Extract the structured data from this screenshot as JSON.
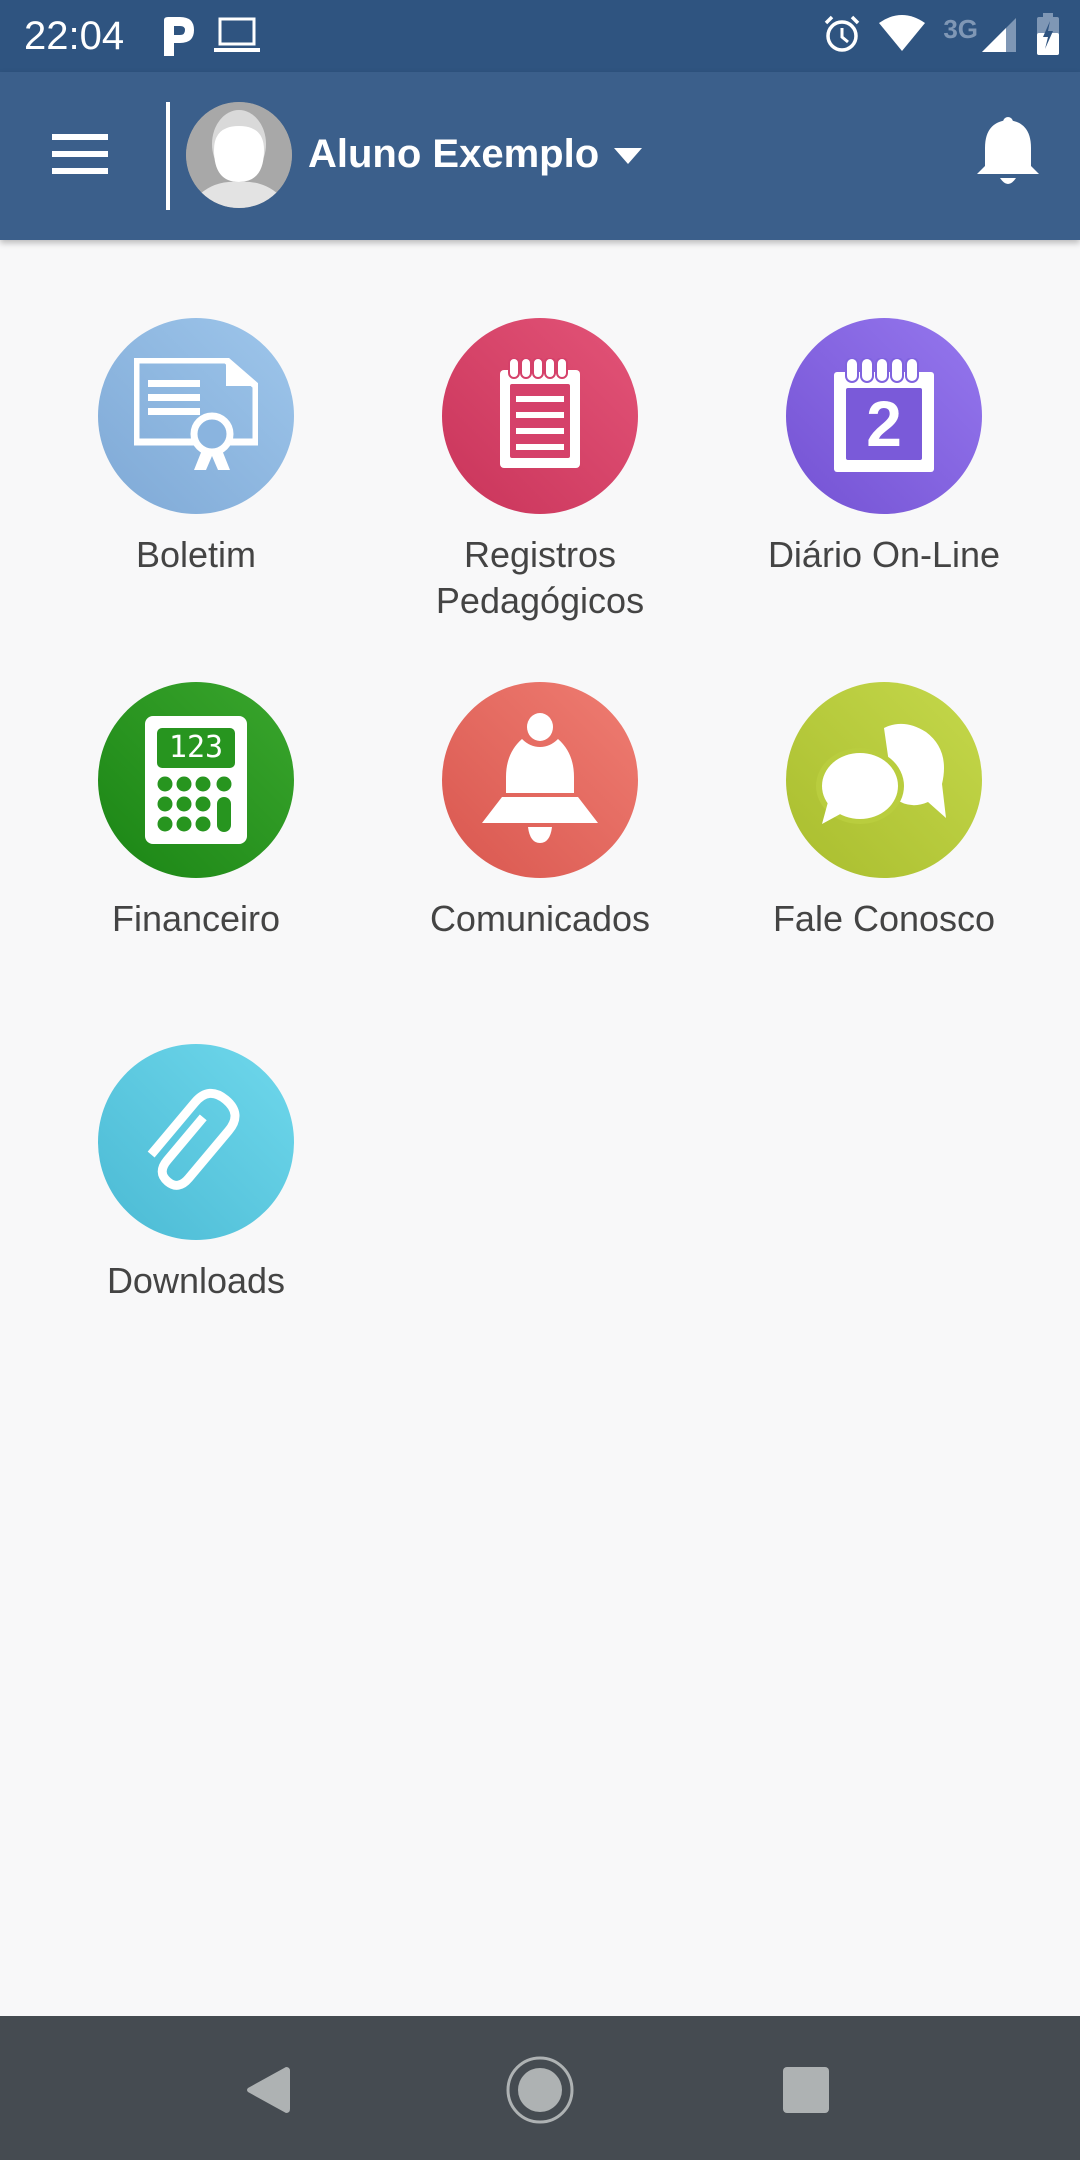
{
  "status_bar": {
    "time": "22:04",
    "left_icons": [
      "parking-p-icon",
      "laptop-icon"
    ],
    "right_icons": [
      "alarm-icon",
      "wifi-icon",
      "signal-icon",
      "battery-charging-icon"
    ],
    "network_label": "3G"
  },
  "app_bar": {
    "menu_icon": "hamburger-menu-icon",
    "profile_name": "Aluno Exemplo",
    "notifications_icon": "bell-icon",
    "color": "#3b5f8b"
  },
  "grid": {
    "items": [
      {
        "label": "Boletim",
        "icon": "certificate-icon",
        "color_start": "#7fa9d6",
        "color_end": "#9ec6eb"
      },
      {
        "label": "Registros Pedagógicos",
        "icon": "notepad-icon",
        "color_start": "#c9345a",
        "color_end": "#e35478"
      },
      {
        "label": "Diário On-Line",
        "icon": "calendar-icon",
        "color_start": "#7452d3",
        "color_end": "#9577ee",
        "calendar_number": "2"
      },
      {
        "label": "Financeiro",
        "icon": "calculator-icon",
        "color_start": "#1b8515",
        "color_end": "#3aa62d",
        "calculator_display": "123"
      },
      {
        "label": "Comunicados",
        "icon": "bell-icon",
        "color_start": "#d9574f",
        "color_end": "#ef7d72"
      },
      {
        "label": "Fale Conosco",
        "icon": "chat-bubbles-icon",
        "color_start": "#a9bd2e",
        "color_end": "#c5d84b"
      },
      {
        "label": "Downloads",
        "icon": "paperclip-icon",
        "color_start": "#4bbad4",
        "color_end": "#6fd8ec"
      }
    ]
  },
  "nav_bar": {
    "back": "back-icon",
    "home": "home-icon",
    "recents": "recents-icon"
  }
}
